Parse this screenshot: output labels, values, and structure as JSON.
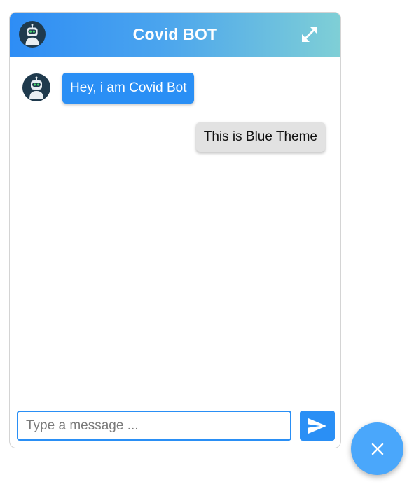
{
  "header": {
    "title": "Covid BOT",
    "avatar_icon": "robot-avatar-icon",
    "expand_icon": "expand-arrows-icon"
  },
  "messages": [
    {
      "sender": "bot",
      "text": "Hey, i am Covid Bot"
    },
    {
      "sender": "user",
      "text": "This is Blue Theme"
    }
  ],
  "composer": {
    "placeholder": "Type a message ...",
    "value": "",
    "send_icon": "send-icon"
  },
  "launcher": {
    "icon": "close-icon"
  },
  "colors": {
    "accent": "#2a8ff5",
    "header_gradient_start": "#2e8df5",
    "header_gradient_end": "#7fcfd6",
    "user_bubble": "#e2e2e2",
    "fab": "#4aa7fb"
  }
}
